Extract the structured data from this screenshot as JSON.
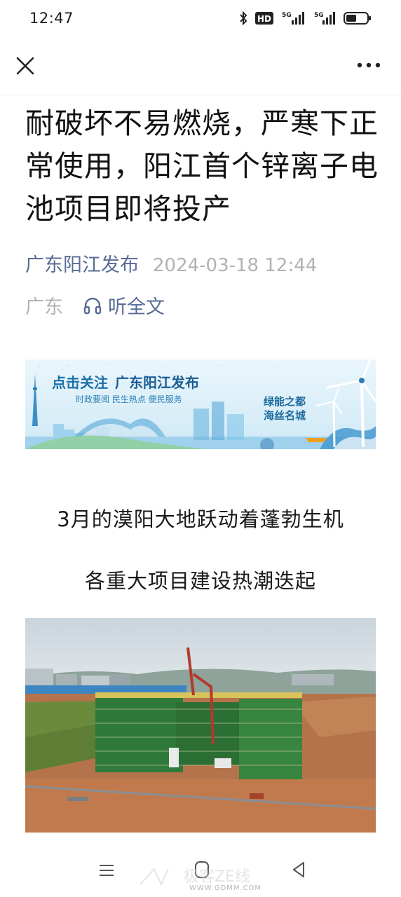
{
  "status_bar": {
    "time": "12:47",
    "icons": [
      "bluetooth-icon",
      "hd-icon",
      "signal-5g-icon",
      "signal-5g-icon",
      "battery-icon"
    ],
    "hd_label": "HD",
    "network_label_1": "5G",
    "network_label_2": "5G"
  },
  "nav": {
    "close_icon": "close-icon",
    "more_icon": "more-icon"
  },
  "article": {
    "title": "耐破坏不易燃烧，严寒下正常使用，阳江首个锌离子电池项目即将投产",
    "author": "广东阳江发布",
    "datetime": "2024-03-18 12:44",
    "region": "广东",
    "listen_label": "听全文",
    "banner": {
      "title_prefix": "点击关注",
      "title_name": "广东阳江发布",
      "subtitle": "时政要闻  民生热点  便民服务",
      "slogan_line1": "绿能之都",
      "slogan_line2": "海丝名城"
    },
    "paragraph_1": "3月的漠阳大地跃动着蓬勃生机",
    "paragraph_2": "各重大项目建设热潮迭起"
  },
  "watermark": {
    "text": "极客ZE线",
    "url": "WWW.GDMM.COM"
  },
  "colors": {
    "link": "#576b95",
    "meta_gray": "#b2b2b2",
    "text": "#1a1a1a"
  }
}
